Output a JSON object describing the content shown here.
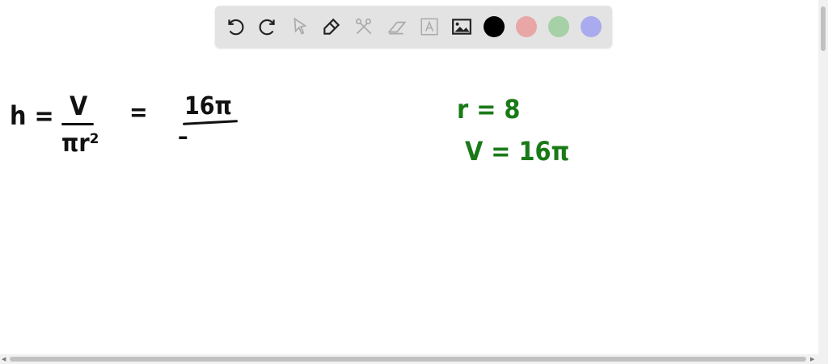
{
  "toolbar": {
    "tools": [
      "undo-icon",
      "redo-icon",
      "select-icon",
      "pen-icon",
      "tools-icon",
      "eraser-icon",
      "text-icon",
      "image-icon"
    ],
    "colors": {
      "black": "#000000",
      "red": "#e8a6a6",
      "green": "#a6d0a6",
      "blue": "#aaaaee"
    }
  },
  "canvas": {
    "formula": {
      "lhs": "h =",
      "num": "V",
      "den": "πr²",
      "eq": "=",
      "num2": "16π",
      "den2": "–"
    },
    "given": {
      "r": "r = 8",
      "v": "V = 16π"
    }
  }
}
